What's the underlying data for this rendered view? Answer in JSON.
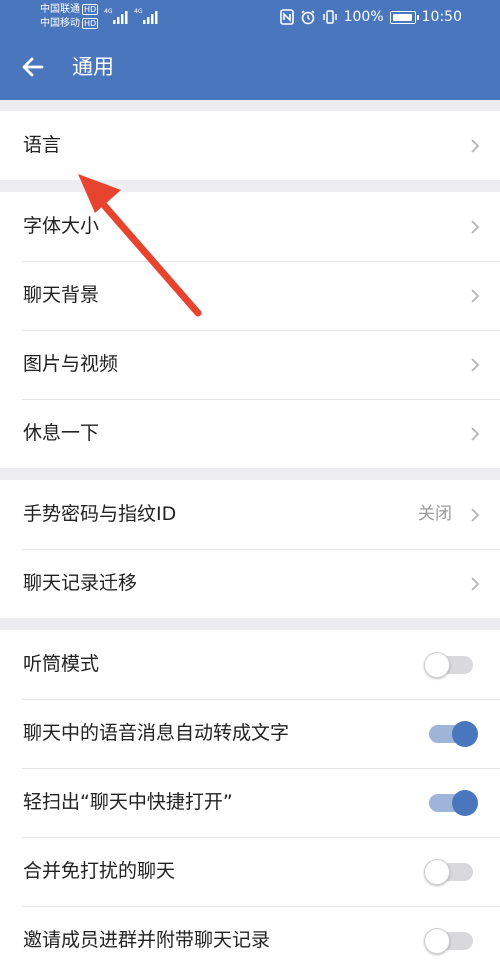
{
  "status_bar": {
    "carrier1": "中国联通",
    "carrier2": "中国移动",
    "hd": "HD",
    "net1": "4G",
    "net2": "4G",
    "battery": "100%",
    "battery_level": 1.0,
    "time": "10:50",
    "icons": [
      "nfc-icon",
      "alarm-icon",
      "vibrate-icon",
      "battery-icon"
    ]
  },
  "app_bar": {
    "title": "通用",
    "back_icon": "arrow-left-icon",
    "color": "#4a76bd"
  },
  "group1": [
    {
      "label": "语言"
    }
  ],
  "group2": [
    {
      "label": "字体大小"
    },
    {
      "label": "聊天背景"
    },
    {
      "label": "图片与视频"
    },
    {
      "label": "休息一下"
    }
  ],
  "group3": [
    {
      "label": "手势密码与指纹ID",
      "value": "关闭"
    },
    {
      "label": "聊天记录迁移"
    }
  ],
  "group4": [
    {
      "label": "听筒模式",
      "enabled": false
    },
    {
      "label": "聊天中的语音消息自动转成文字",
      "enabled": true
    },
    {
      "label": "轻扫出“聊天中快捷打开”",
      "enabled": true
    },
    {
      "label": "合并免打扰的聊天",
      "enabled": false
    },
    {
      "label": "邀请成员进群并附带聊天记录",
      "enabled": false
    }
  ],
  "annotation": {
    "color": "#e8432f",
    "points_to": "语言"
  }
}
